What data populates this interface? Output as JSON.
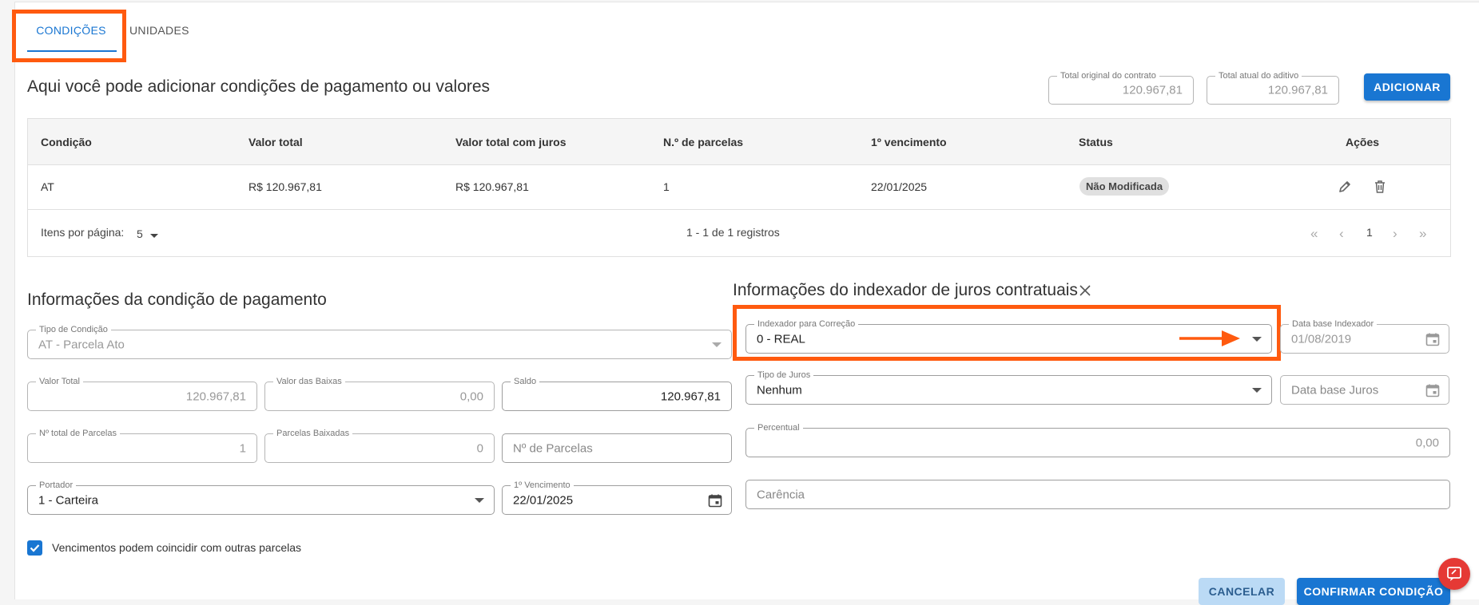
{
  "tabs": [
    {
      "label": "CONDIÇÕES"
    },
    {
      "label": "UNIDADES"
    }
  ],
  "header": {
    "title": "Aqui você pode adicionar condições de pagamento ou valores",
    "total_original": {
      "label": "Total original do contrato",
      "value": "120.967,81"
    },
    "total_atual": {
      "label": "Total atual do aditivo",
      "value": "120.967,81"
    },
    "add_button": "ADICIONAR"
  },
  "table": {
    "columns": [
      "Condição",
      "Valor total",
      "Valor total com juros",
      "N.º de parcelas",
      "1º vencimento",
      "Status",
      "Ações"
    ],
    "rows": [
      {
        "condicao": "AT",
        "valor_total": "R$ 120.967,81",
        "valor_juros": "R$ 120.967,81",
        "parcelas": "1",
        "vencimento": "22/01/2025",
        "status": "Não Modificada"
      }
    ],
    "footer": {
      "items_per_page_label": "Itens por página:",
      "items_per_page": "5",
      "range": "1 - 1 de 1 registros",
      "page": "1"
    }
  },
  "payment_info": {
    "title": "Informações da condição de pagamento",
    "tipo_condicao": {
      "label": "Tipo de Condição",
      "value": "AT - Parcela Ato"
    },
    "valor_total": {
      "label": "Valor Total",
      "value": "120.967,81"
    },
    "valor_baixas": {
      "label": "Valor das Baixas",
      "value": "0,00"
    },
    "saldo": {
      "label": "Saldo",
      "value": "120.967,81"
    },
    "total_parcelas": {
      "label": "Nº total de Parcelas",
      "value": "1"
    },
    "parcelas_baixadas": {
      "label": "Parcelas Baixadas",
      "value": "0"
    },
    "num_parcelas": {
      "placeholder": "Nº de Parcelas"
    },
    "portador": {
      "label": "Portador",
      "value": "1 - Carteira"
    },
    "vencimento": {
      "label": "1º Vencimento",
      "value": "22/01/2025"
    },
    "checkbox_label": "Vencimentos podem coincidir com outras parcelas"
  },
  "indexer_info": {
    "title": "Informações do indexador de juros contratuais",
    "indexador": {
      "label": "Indexador para Correção",
      "value": "0 - REAL"
    },
    "data_base_indexador": {
      "label": "Data base Indexador",
      "value": "01/08/2019"
    },
    "tipo_juros": {
      "label": "Tipo de Juros",
      "value": "Nenhum"
    },
    "data_base_juros": {
      "placeholder": "Data base Juros"
    },
    "percentual": {
      "label": "Percentual",
      "value": "0,00"
    },
    "carencia": {
      "placeholder": "Carência"
    }
  },
  "actions": {
    "cancel": "CANCELAR",
    "confirm": "CONFIRMAR CONDIÇÃO"
  },
  "colors": {
    "primary": "#1976d2",
    "highlight": "#ff5a0f",
    "danger": "#e53935"
  }
}
